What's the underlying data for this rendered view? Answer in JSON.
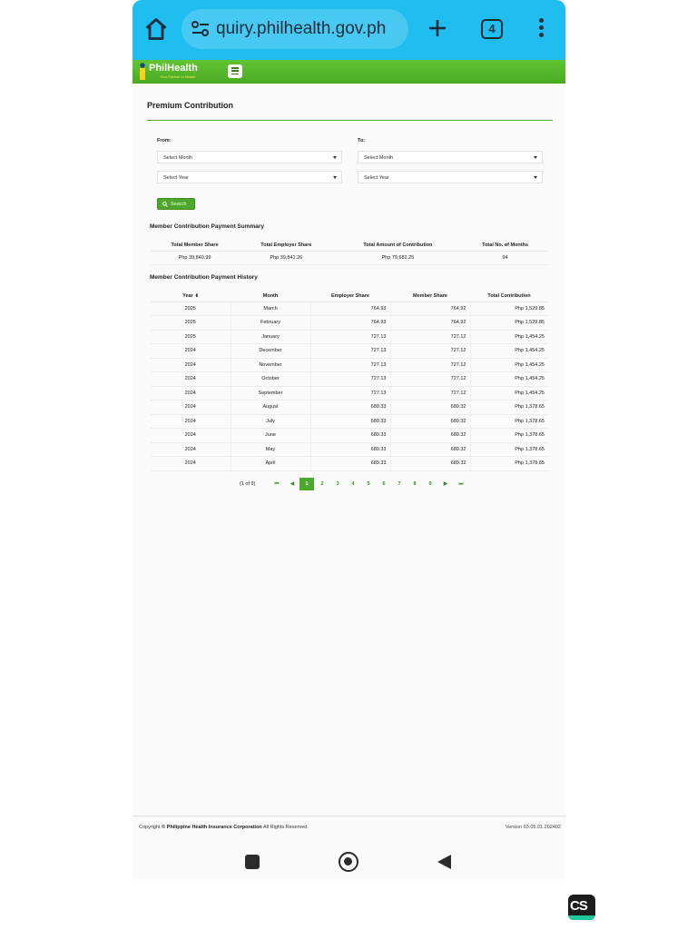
{
  "browser": {
    "url": "quiry.philhealth.gov.ph",
    "tab_count": "4",
    "accent_color": "#20bdf0"
  },
  "site": {
    "logo_text": "PhilHealth",
    "logo_tagline": "Your Partner in Health",
    "brand_color": "#4ea82d"
  },
  "page": {
    "title": "Premium Contribution",
    "from_label": "From:",
    "to_label": "To:",
    "from_month": "Select Month",
    "from_year": "Select Year",
    "to_month": "Select Month",
    "to_year": "Select Year",
    "search_label": "Search"
  },
  "summary": {
    "heading": "Member Contribution Payment Summary",
    "headers": [
      "Total Member Share",
      "Total Employer Share",
      "Total Amount of Contribution",
      "Total No. of Months"
    ],
    "values": [
      "Php 39,840.99",
      "Php 39,841.26",
      "Php 79,682.25",
      "94"
    ]
  },
  "history": {
    "heading": "Member Contribution Payment History",
    "headers": [
      "Year",
      "Month",
      "Employer Share",
      "Member Share",
      "Total Contribution"
    ],
    "rows": [
      [
        "2025",
        "March",
        "764.93",
        "764.92",
        "Php 1,529.85"
      ],
      [
        "2025",
        "February",
        "764.93",
        "764.92",
        "Php 1,529.85"
      ],
      [
        "2025",
        "January",
        "727.13",
        "727.12",
        "Php 1,454.25"
      ],
      [
        "2024",
        "December",
        "727.13",
        "727.12",
        "Php 1,454.25"
      ],
      [
        "2024",
        "November",
        "727.13",
        "727.12",
        "Php 1,454.25"
      ],
      [
        "2024",
        "October",
        "727.13",
        "727.12",
        "Php 1,454.25"
      ],
      [
        "2024",
        "September",
        "727.13",
        "727.12",
        "Php 1,454.25"
      ],
      [
        "2024",
        "August",
        "689.33",
        "689.32",
        "Php 1,378.65"
      ],
      [
        "2024",
        "July",
        "689.33",
        "689.32",
        "Php 1,378.65"
      ],
      [
        "2024",
        "June",
        "689.33",
        "689.32",
        "Php 1,378.65"
      ],
      [
        "2024",
        "May",
        "689.33",
        "689.32",
        "Php 1,378.65"
      ],
      [
        "2024",
        "April",
        "689.33",
        "689.32",
        "Php 1,378.65"
      ]
    ]
  },
  "pagination": {
    "info": "(1 of 9)",
    "pages": [
      "1",
      "2",
      "3",
      "4",
      "5",
      "6",
      "7",
      "8",
      "9"
    ],
    "current": "1",
    "first": "⏮",
    "prev": "◀",
    "next": "▶",
    "last": "⏭"
  },
  "footer": {
    "copyright_prefix": "Copyright",
    "copyright_org": "© Philippine Health Insurance Corporation",
    "copyright_suffix": "All Rights Reserved.",
    "version": "Version 03.05.01.202402"
  },
  "watermark": {
    "text": "CS"
  }
}
